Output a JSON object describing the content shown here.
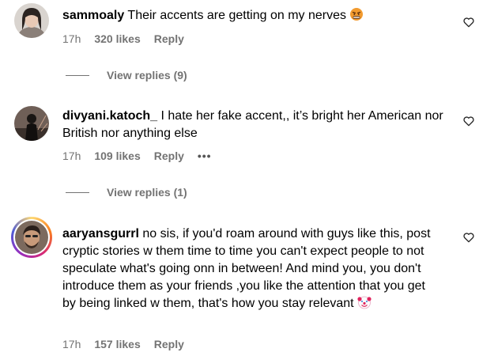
{
  "comments": [
    {
      "username": "sammoaly",
      "text": "Their accents are getting on my nerves",
      "time": "17h",
      "likes": "320 likes",
      "reply_label": "Reply",
      "view_replies": "View replies (9)",
      "avatar_icon": "profile-photo-woman",
      "emoji_icon": "angry-face-emoji"
    },
    {
      "username": "divyani.katoch_",
      "text": "I hate her fake accent,, it’s bright her American nor British nor anything else",
      "time": "17h",
      "likes": "109 likes",
      "reply_label": "Reply",
      "more_label": "•••",
      "view_replies": "View replies (1)",
      "avatar_icon": "profile-photo-silhouette"
    },
    {
      "username": "aaryansgurrl",
      "text": "no sis, if you'd roam around with guys like this, post cryptic stories w them time to time you can't expect people to not speculate what's going onn in between! And mind you, you don't introduce them as your friends ,you like the attention that you get by being linked w them, that's how you stay relevant",
      "time": "17h",
      "likes": "157 likes",
      "reply_label": "Reply",
      "avatar_icon": "profile-photo-man-story-ring",
      "emoji_icon": "clown-face-emoji"
    }
  ],
  "colors": {
    "meta_gray": "#737373",
    "text": "#000000",
    "background": "#ffffff"
  }
}
